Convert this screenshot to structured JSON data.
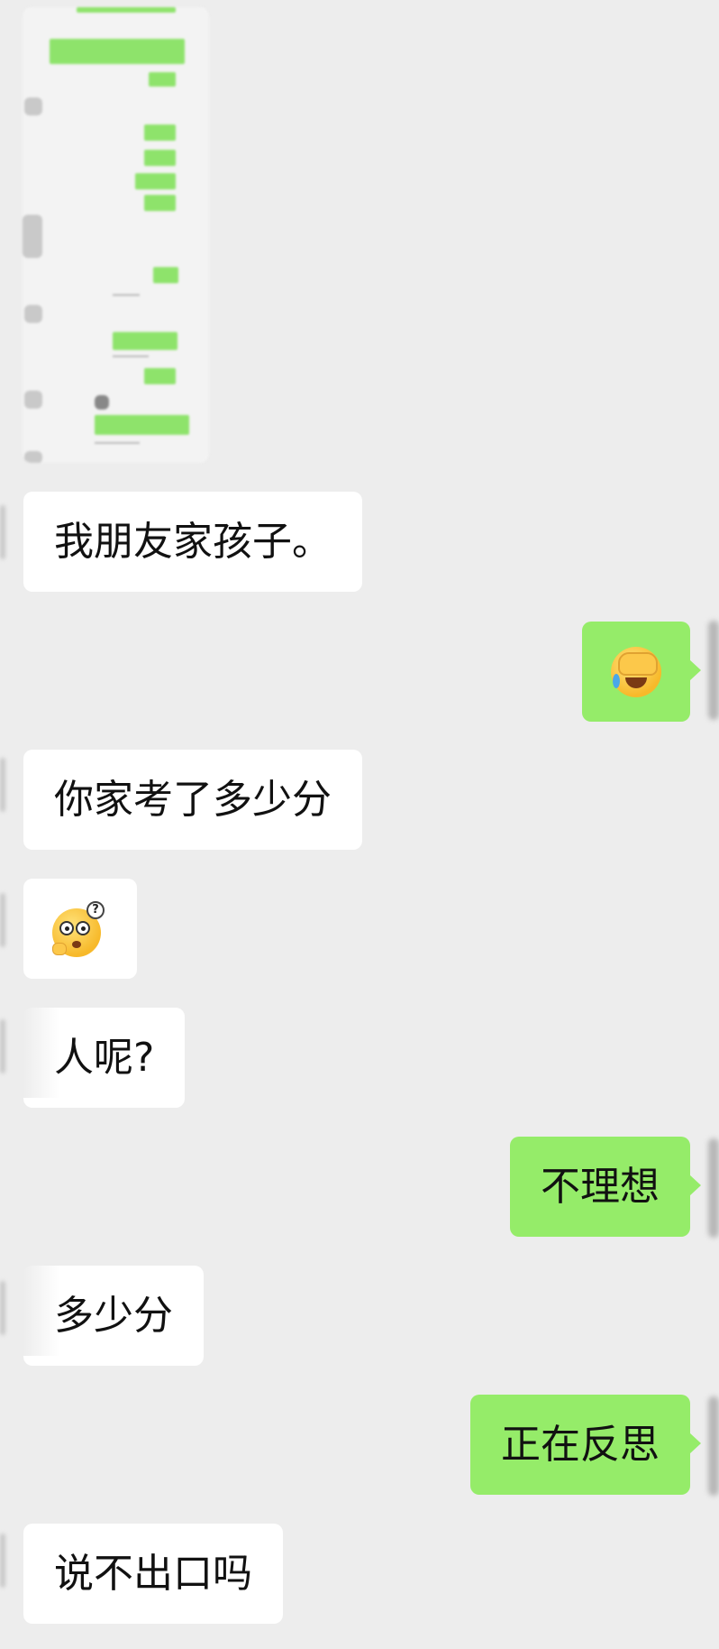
{
  "chat": {
    "messages": [
      {
        "side": "in",
        "text": "我朋友家孩子。"
      },
      {
        "side": "out",
        "emoji": "facepalm-emoji"
      },
      {
        "side": "in",
        "text": "你家考了多少分"
      },
      {
        "side": "in",
        "emoji": "confused-emoji"
      },
      {
        "side": "in",
        "text": "人呢?"
      },
      {
        "side": "out",
        "text": "不理想"
      },
      {
        "side": "in",
        "text": "多少分"
      },
      {
        "side": "out",
        "text": "正在反思"
      },
      {
        "side": "in",
        "text": "说不出口吗"
      }
    ]
  },
  "colors": {
    "background": "#ededed",
    "incoming_bubble": "#ffffff",
    "outgoing_bubble": "#95ec69",
    "text": "#111111"
  }
}
